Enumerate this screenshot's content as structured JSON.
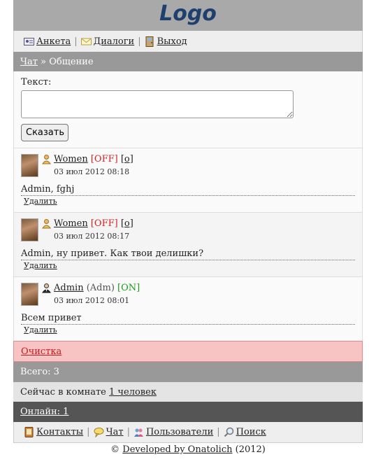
{
  "logo": "Logo",
  "topnav": {
    "profile": "Анкета",
    "dialogs": "Диалоги",
    "logout": "Выход",
    "sep": "|"
  },
  "crumb": {
    "link": "Чат",
    "sep": "»",
    "current": "Общение"
  },
  "form": {
    "label": "Текст:",
    "button": "Сказать"
  },
  "messages": [
    {
      "name": "Women",
      "status": "[OFF]",
      "extra": "[о]",
      "date": "03 июл 2012 08:18",
      "text": "Admin, fghj",
      "delete": "Удалить"
    },
    {
      "name": "Women",
      "status": "[OFF]",
      "extra": "[о]",
      "date": "03 июл 2012 08:17",
      "text": "Admin, ну привет. Как твои делишки?",
      "delete": "Удалить"
    },
    {
      "name": "Admin",
      "role": "(Adm)",
      "status": "[ON]",
      "date": "03 июл 2012 08:01",
      "text": "Всем привет",
      "delete": "Удалить"
    }
  ],
  "clear": "Очистка",
  "total": "Всего: 3",
  "room": {
    "prefix": "Сейчас в комнате",
    "link": "1 человек"
  },
  "online": "Онлайн: 1",
  "bottomnav": {
    "contacts": "Контакты",
    "chat": "Чат",
    "users": "Пользователи",
    "search": "Поиск",
    "sep": "|"
  },
  "footer": {
    "copy": "©",
    "link": "Developed by Onatolich",
    "year": "(2012)"
  }
}
